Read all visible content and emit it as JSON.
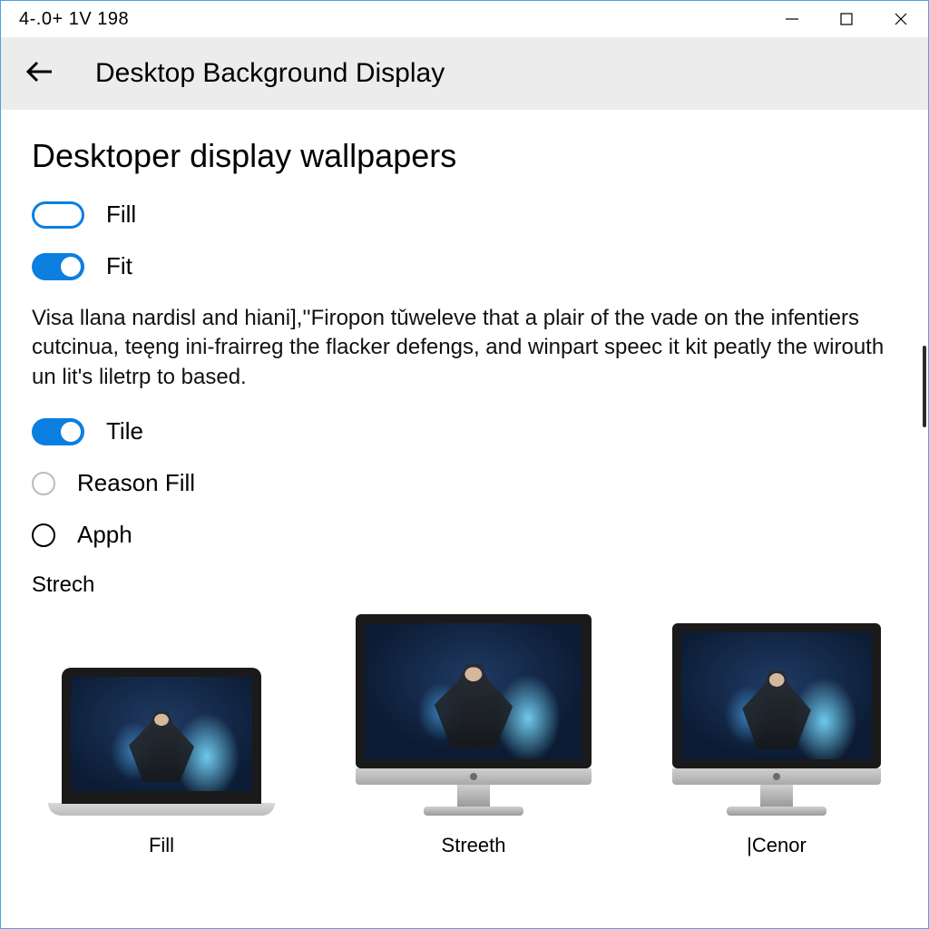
{
  "titlebar": {
    "text": "4-.0+ 1V 198"
  },
  "header": {
    "title": "Desktop Background Display"
  },
  "page": {
    "title": "Desktoper display wallpapers",
    "description": "Visa llana nardisl and hiani],''Firopon tǔweleve that a plair of the vade on the infentiers cutcinua, teęng ini-frairreg the flacker defengs, and winpart speec it kit peatly the wirouth un lit's liletrp to based."
  },
  "options": {
    "fill": {
      "label": "Fill"
    },
    "fit": {
      "label": "Fit"
    },
    "tile": {
      "label": "Tile"
    },
    "reason": {
      "label": "Reason Fill"
    },
    "apph": {
      "label": "Apph"
    },
    "strech": {
      "label": "Strech"
    }
  },
  "previews": {
    "fill": {
      "caption": "Fill"
    },
    "streeth": {
      "caption": "Streeth"
    },
    "cenor": {
      "caption": "|Cenor"
    }
  }
}
